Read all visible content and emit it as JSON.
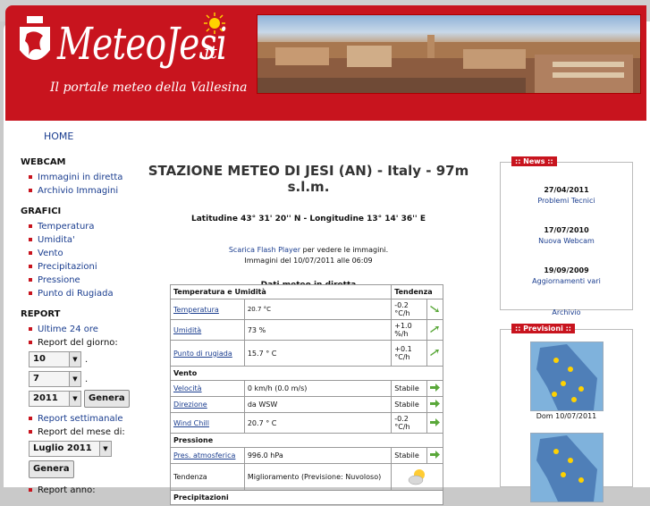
{
  "site": {
    "logo_text": "MeteoJesi",
    "logo_suffix": ".it",
    "tagline": "Il portale meteo della Vallesina"
  },
  "nav": {
    "home": "HOME"
  },
  "sidebar": {
    "webcam_title": "WEBCAM",
    "webcam_items": [
      "Immagini in diretta",
      "Archivio Immagini"
    ],
    "grafici_title": "GRAFICI",
    "grafici_items": [
      "Temperatura",
      "Umidita'",
      "Vento",
      "Precipitazioni",
      "Pressione",
      "Punto di Rugiada"
    ],
    "report_title": "REPORT",
    "report_last24": "Ultime 24 ore",
    "report_day_label": "Report del giorno:",
    "day_value": "10",
    "month_value": "7",
    "year_value": "2011",
    "genera": "Genera",
    "weekly": "Report settimanale",
    "month_label": "Report del mese di:",
    "month_select": "Luglio 2011",
    "year_label": "Report anno:",
    "dot": "."
  },
  "main": {
    "title": "STAZIONE METEO DI JESI (AN) - Italy - 97m s.l.m.",
    "coords": "Latitudine 43° 31' 20'' N - Longitudine 13° 14' 36'' E",
    "flash_link": "Scarica Flash Player",
    "flash_text": " per vedere le immagini.",
    "images_date": "Immagini del 10/07/2011 alle 06:09",
    "live_title": "Dati meteo in diretta"
  },
  "table": {
    "head_temp": "Temperatura e Umidità",
    "head_trend": "Tendenza",
    "rows_temp": [
      {
        "label": "Temperatura",
        "value": "20.7 °C",
        "trend": "-0.2 °C/h",
        "dir": "down"
      },
      {
        "label": "Umidità",
        "value": "73 %",
        "trend": "+1.0 %/h",
        "dir": "up"
      },
      {
        "label": "Punto di rugiada",
        "value": "15.7 ° C",
        "trend": "+0.1 °C/h",
        "dir": "up"
      }
    ],
    "head_wind": "Vento",
    "rows_wind": [
      {
        "label": "Velocità",
        "value": "0 km/h (0.0 m/s)",
        "trend": "Stabile"
      },
      {
        "label": "Direzione",
        "value": "da WSW",
        "trend": "Stabile"
      },
      {
        "label": "Wind Chill",
        "value": "20.7 ° C",
        "trend": "-0.2 °C/h",
        "dir": "right"
      }
    ],
    "head_press": "Pressione",
    "rows_press": [
      {
        "label": "Pres. atmosferica",
        "value": "996.0 hPa",
        "trend": "Stabile"
      }
    ],
    "tendenza_label": "Tendenza",
    "tendenza_value": "Miglioramento (Previsione: Nuvoloso)",
    "next_head": "Precipitazioni"
  },
  "news": {
    "title": ":: News ::",
    "items": [
      {
        "date": "27/04/2011",
        "text": "Problemi Tecnici"
      },
      {
        "date": "17/07/2010",
        "text": "Nuova Webcam"
      },
      {
        "date": "19/09/2009",
        "text": "Aggiornamenti vari"
      }
    ],
    "archive": "Archivio"
  },
  "forecast": {
    "title": ":: Previsioni ::",
    "day1": "Dom 10/07/2011"
  },
  "colors": {
    "brand_red": "#c8141e",
    "link_blue": "#1a3d8f"
  }
}
